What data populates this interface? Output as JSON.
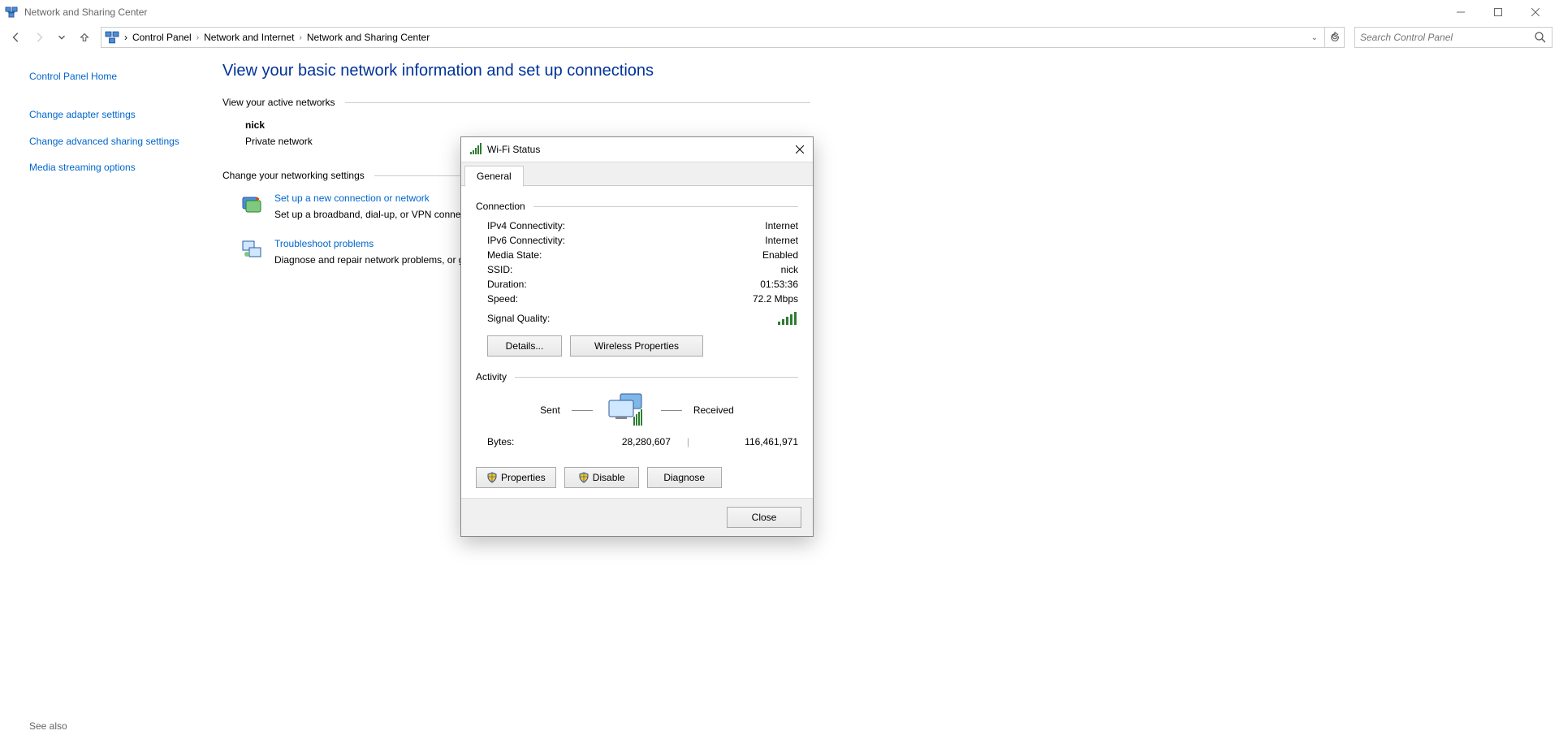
{
  "window": {
    "title": "Network and Sharing Center"
  },
  "breadcrumb": {
    "item1": "Control Panel",
    "item2": "Network and Internet",
    "item3": "Network and Sharing Center"
  },
  "search": {
    "placeholder": "Search Control Panel"
  },
  "sidebar": {
    "home": "Control Panel Home",
    "link1": "Change adapter settings",
    "link2": "Change advanced sharing settings",
    "link3": "Media streaming options",
    "seealso": "See also"
  },
  "main": {
    "heading": "View your basic network information and set up connections",
    "sectionActive": "View your active networks",
    "network": {
      "name": "nick",
      "type": "Private network"
    },
    "sectionChange": "Change your networking settings",
    "task1": {
      "title": "Set up a new connection or network",
      "desc": "Set up a broadband, dial-up, or VPN connection; or set up a router or access point."
    },
    "task2": {
      "title": "Troubleshoot problems",
      "desc": "Diagnose and repair network problems, or get troubleshooting information."
    }
  },
  "dialog": {
    "title": "Wi-Fi Status",
    "tab": "General",
    "groupConnection": "Connection",
    "fields": {
      "ipv4_label": "IPv4 Connectivity:",
      "ipv4_value": "Internet",
      "ipv6_label": "IPv6 Connectivity:",
      "ipv6_value": "Internet",
      "media_label": "Media State:",
      "media_value": "Enabled",
      "ssid_label": "SSID:",
      "ssid_value": "nick",
      "duration_label": "Duration:",
      "duration_value": "01:53:36",
      "speed_label": "Speed:",
      "speed_value": "72.2 Mbps",
      "signal_label": "Signal Quality:"
    },
    "btnDetails": "Details...",
    "btnWireless": "Wireless Properties",
    "groupActivity": "Activity",
    "sentLabel": "Sent",
    "receivedLabel": "Received",
    "bytesLabel": "Bytes:",
    "bytesSent": "28,280,607",
    "bytesReceived": "116,461,971",
    "btnProperties": "Properties",
    "btnDisable": "Disable",
    "btnDiagnose": "Diagnose",
    "btnClose": "Close"
  }
}
